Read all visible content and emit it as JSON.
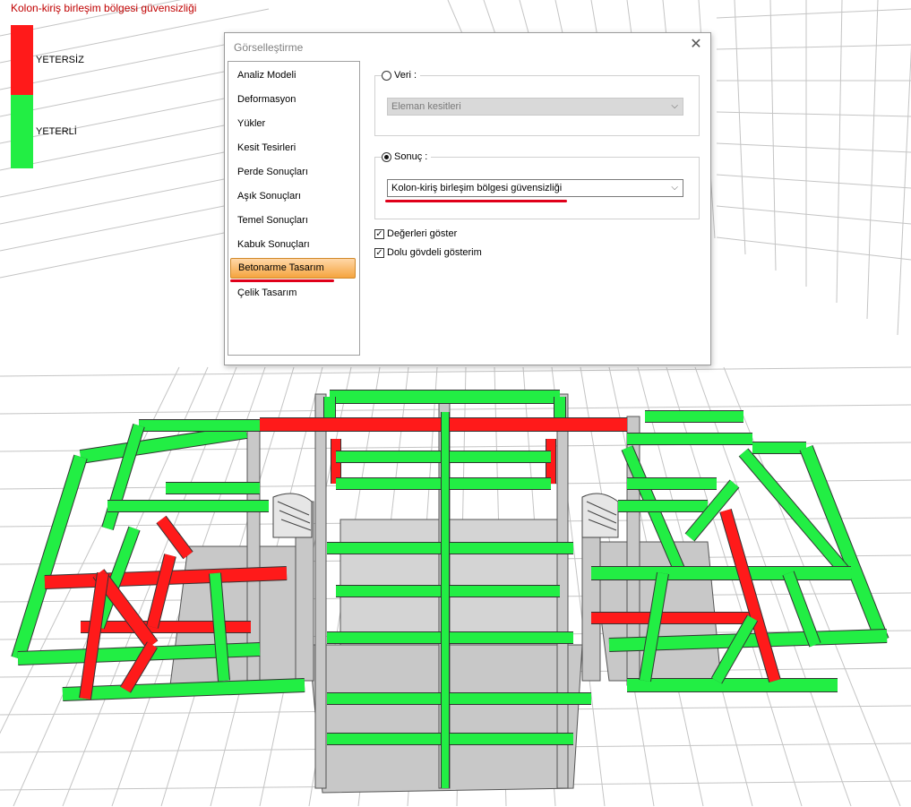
{
  "legend": {
    "title": "Kolon-kiriş birleşim bölgesi güvensizliği",
    "items": [
      {
        "label": "YETERSİZ",
        "color": "#ff1a1a"
      },
      {
        "label": "YETERLİ",
        "color": "#22ee44"
      }
    ]
  },
  "dialog": {
    "title": "Görselleştirme",
    "menu": [
      {
        "label": "Analiz Modeli"
      },
      {
        "label": "Deformasyon"
      },
      {
        "label": "Yükler"
      },
      {
        "label": "Kesit Tesirleri"
      },
      {
        "label": "Perde Sonuçları"
      },
      {
        "label": "Aşık Sonuçları"
      },
      {
        "label": "Temel Sonuçları"
      },
      {
        "label": "Kabuk Sonuçları"
      },
      {
        "label": "Betonarme Tasarım"
      },
      {
        "label": "Çelik Tasarım"
      }
    ],
    "active_menu": "Betonarme Tasarım",
    "veri": {
      "label": "Veri :",
      "selected": false,
      "value": "Eleman kesitleri"
    },
    "sonuc": {
      "label": "Sonuç :",
      "selected": true,
      "value": "Kolon-kiriş birleşim bölgesi güvensizliği"
    },
    "options": [
      {
        "label": "Değerleri göster",
        "checked": true
      },
      {
        "label": "Dolu gövdeli gösterim",
        "checked": true
      }
    ]
  },
  "colors": {
    "fail": "#ff1a1a",
    "pass": "#22ee44",
    "column": "#c8c8c8",
    "grid": "#c4c4c4",
    "highlight": "#e0001a"
  }
}
